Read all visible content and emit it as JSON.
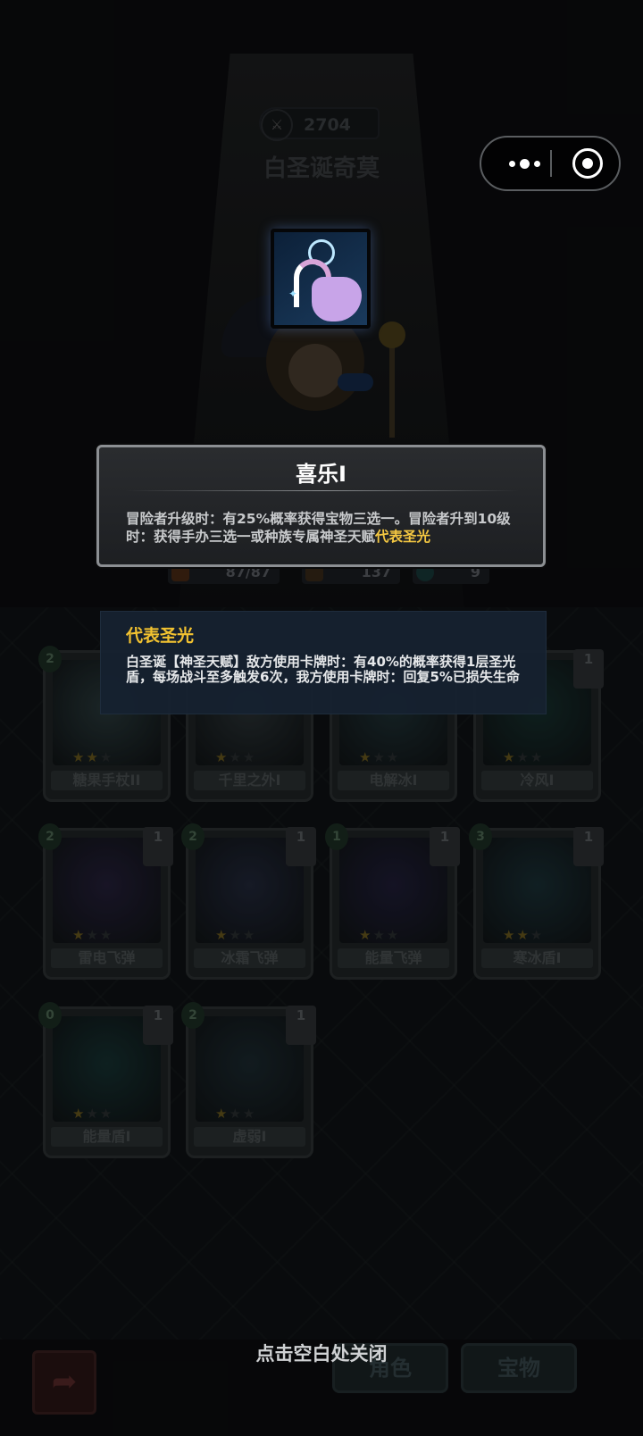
{
  "header": {
    "score_icon": "crossed-swords-icon",
    "score": "2704",
    "hero_name": "白圣诞奇莫"
  },
  "capsule": {
    "more_icon": "more-dots-icon",
    "close_icon": "target-circle-icon"
  },
  "relic": {
    "icon": "candy-bag-icon"
  },
  "stats": {
    "hp": "87/87",
    "attack": "137",
    "mana": "9"
  },
  "talent": {
    "title": "喜乐I",
    "description_plain": "冒险者升级时：有25%概率获得宝物三选一。冒险者升到10级时：获得手办三选一或种族专属神圣天赋",
    "description_highlight": "代表圣光"
  },
  "keyword": {
    "title": "代表圣光",
    "description": "白圣诞【神圣天赋】敌方使用卡牌时：有40%的概率获得1层圣光盾，每场战斗至多触发6次，我方使用卡牌时：回复5%已损失生命"
  },
  "cards": [
    {
      "name": "糖果手杖II",
      "cost": "2",
      "level": "",
      "stars": 2,
      "accent": "#2a3a3c"
    },
    {
      "name": "千里之外I",
      "cost": "",
      "level": "",
      "stars": 1,
      "accent": "#2b3336"
    },
    {
      "name": "电解冰I",
      "cost": "",
      "level": "",
      "stars": 1,
      "accent": "#203236"
    },
    {
      "name": "冷风I",
      "cost": "",
      "level": "1",
      "stars": 1,
      "accent": "#16302e"
    },
    {
      "name": "雷电飞弹",
      "cost": "2",
      "level": "1",
      "stars": 1,
      "accent": "#25203a"
    },
    {
      "name": "冰霜飞弹",
      "cost": "2",
      "level": "1",
      "stars": 1,
      "accent": "#22283a"
    },
    {
      "name": "能量飞弹",
      "cost": "1",
      "level": "1",
      "stars": 1,
      "accent": "#201e38"
    },
    {
      "name": "寒冰盾I",
      "cost": "3",
      "level": "1",
      "stars": 2,
      "accent": "#1a3036"
    },
    {
      "name": "能量盾I",
      "cost": "0",
      "level": "1",
      "stars": 1,
      "accent": "#163232"
    },
    {
      "name": "虚弱I",
      "cost": "2",
      "level": "1",
      "stars": 1,
      "accent": "#1c2a30"
    }
  ],
  "bottom": {
    "close_hint": "点击空白处关闭",
    "back_icon": "back-arrow-icon",
    "tab_role": "角色",
    "tab_treasure": "宝物"
  },
  "colors": {
    "highlight": "#f5c842",
    "keyword_title": "#f2c230",
    "tooltip_bg": "#162130"
  }
}
